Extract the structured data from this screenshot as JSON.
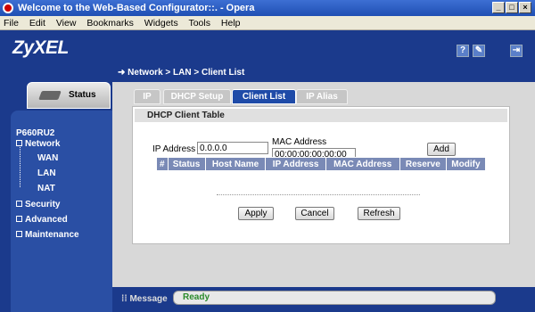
{
  "window": {
    "title": "Welcome to the Web-Based Configurator::. - Opera"
  },
  "menu": [
    "File",
    "Edit",
    "View",
    "Bookmarks",
    "Widgets",
    "Tools",
    "Help"
  ],
  "header": {
    "logo": "ZyXEL"
  },
  "breadcrumb": "Network > LAN > Client List",
  "sidebar": {
    "status_tab": "Status",
    "model": "P660RU2",
    "items": [
      {
        "label": "Network",
        "marker": "-"
      },
      {
        "label": "Security",
        "marker": "+"
      },
      {
        "label": "Advanced",
        "marker": "+"
      },
      {
        "label": "Maintenance",
        "marker": "+"
      }
    ],
    "network_sub": [
      "WAN",
      "LAN",
      "NAT"
    ]
  },
  "tabs": [
    {
      "label": "IP"
    },
    {
      "label": "DHCP Setup"
    },
    {
      "label": "Client List"
    },
    {
      "label": "IP Alias"
    }
  ],
  "panel": {
    "title": "DHCP Client Table",
    "ip_label": "IP Address",
    "ip_value": "0.0.0.0",
    "mac_label": "MAC Address",
    "mac_value": "00:00:00:00:00:00",
    "add_button": "Add",
    "columns": [
      "#",
      "Status",
      "Host Name",
      "IP Address",
      "MAC Address",
      "Reserve",
      "Modify"
    ],
    "apply_button": "Apply",
    "cancel_button": "Cancel",
    "refresh_button": "Refresh"
  },
  "message": {
    "label": "Message",
    "text": "Ready"
  }
}
